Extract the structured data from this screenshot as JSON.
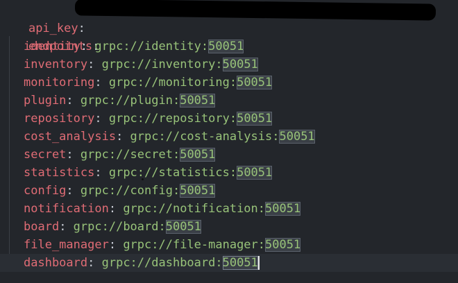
{
  "editor": {
    "line1": {
      "key": "api_key",
      "colon": ":"
    },
    "line2": {
      "key": "endpoints",
      "colon": ":"
    },
    "endpoints": [
      {
        "key": "identity",
        "url": "grpc://identity:",
        "port": "50051"
      },
      {
        "key": "inventory",
        "url": "grpc://inventory:",
        "port": "50051"
      },
      {
        "key": "monitoring",
        "url": "grpc://monitoring:",
        "port": "50051"
      },
      {
        "key": "plugin",
        "url": "grpc://plugin:",
        "port": "50051"
      },
      {
        "key": "repository",
        "url": "grpc://repository:",
        "port": "50051"
      },
      {
        "key": "cost_analysis",
        "url": "grpc://cost-analysis:",
        "port": "50051"
      },
      {
        "key": "secret",
        "url": "grpc://secret:",
        "port": "50051"
      },
      {
        "key": "statistics",
        "url": "grpc://statistics:",
        "port": "50051"
      },
      {
        "key": "config",
        "url": "grpc://config:",
        "port": "50051"
      },
      {
        "key": "notification",
        "url": "grpc://notification:",
        "port": "50051"
      },
      {
        "key": "board",
        "url": "grpc://board:",
        "port": "50051"
      },
      {
        "key": "file_manager",
        "url": "grpc://file-manager:",
        "port": "50051"
      },
      {
        "key": "dashboard",
        "url": "grpc://dashboard:",
        "port": "50051"
      }
    ]
  },
  "colors": {
    "background": "#23262b",
    "key": "#e06c75",
    "string": "#98c379",
    "highlight": "#3a3f46"
  }
}
